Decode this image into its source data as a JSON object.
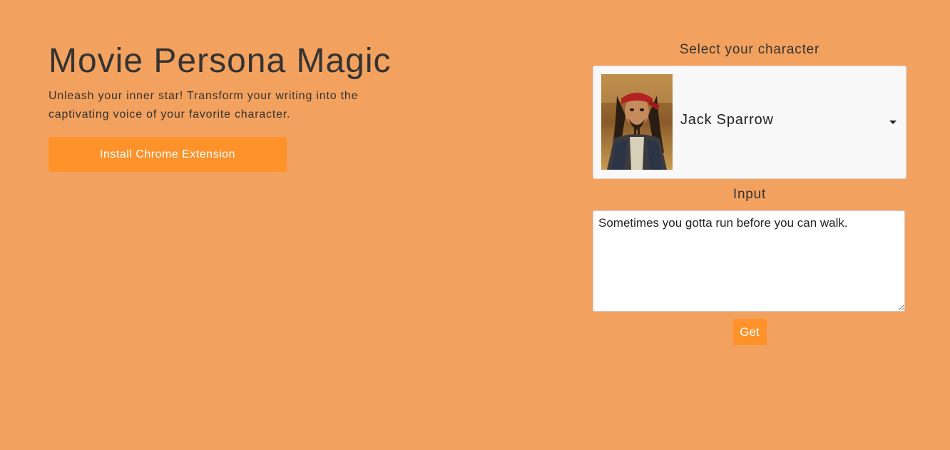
{
  "hero": {
    "title": "Movie Persona Magic",
    "subtitle": "Unleash your inner star! Transform your writing into the captivating voice of your favorite character.",
    "install_label": "Install Chrome Extension"
  },
  "panel": {
    "select_label": "Select your character",
    "selected_character": "Jack Sparrow",
    "input_label": "Input",
    "input_value": "Sometimes you gotta run before you can walk.",
    "get_label": "Get"
  },
  "colors": {
    "background": "#f3a15e",
    "accent": "#ff922b",
    "text": "#333333"
  },
  "icons": {
    "dropdown": "caret-down-icon",
    "resize": "resize-handle-icon"
  }
}
